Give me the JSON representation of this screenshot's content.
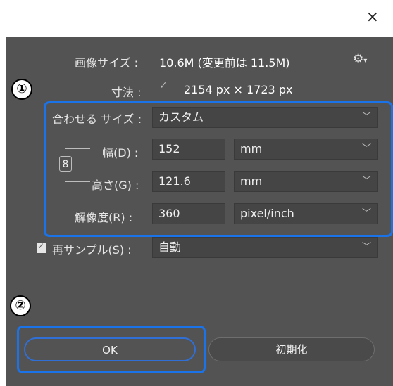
{
  "window": {
    "close_label": "×"
  },
  "image_size": {
    "label": "画像サイズ :",
    "value": "10.6M (変更前は 11.5M)",
    "menu_icon": "gear-icon"
  },
  "dimensions": {
    "label": "寸法 :",
    "value": "2154 px × 1723 px"
  },
  "fit_to": {
    "label": "合わせる サイズ :",
    "value": "カスタム"
  },
  "width": {
    "label": "幅(D) :",
    "value": "152",
    "unit": "mm"
  },
  "height": {
    "label": "高さ(G) :",
    "value": "121.6",
    "unit": "mm"
  },
  "resolution": {
    "label": "解像度(R) :",
    "value": "360",
    "unit": "pixel/inch"
  },
  "resample": {
    "label": "再サンプル(S) :",
    "value": "自動",
    "checked": true
  },
  "buttons": {
    "ok": "OK",
    "reset": "初期化"
  },
  "callouts": {
    "one": "①",
    "two": "②"
  },
  "colors": {
    "highlight": "#1a73e8",
    "panel": "#535353",
    "field": "#454545"
  }
}
